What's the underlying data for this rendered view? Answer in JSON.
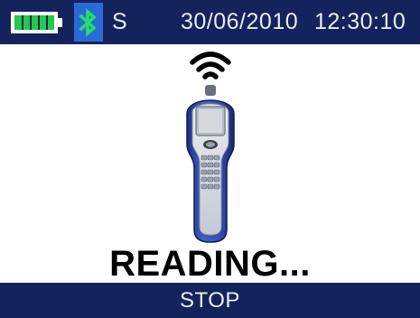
{
  "status_bar": {
    "battery_icon": "battery-full-icon",
    "battery_level": 1.0,
    "bluetooth_icon": "bluetooth-icon",
    "mode_letter": "S",
    "date": "30/06/2010",
    "time": "12:30:10"
  },
  "main": {
    "signal_icon": "wireless-signal-icon",
    "device_icon": "handheld-reader-icon",
    "message": "READING..."
  },
  "softkey": {
    "label": "STOP"
  },
  "colors": {
    "bar_background": "#15235c",
    "bar_text": "#e8ecf7",
    "battery_green": "#22c94a",
    "bluetooth_blue": "#2a6ad8",
    "bluetooth_glyph": "#22e066",
    "device_blue": "#2b43a3"
  }
}
